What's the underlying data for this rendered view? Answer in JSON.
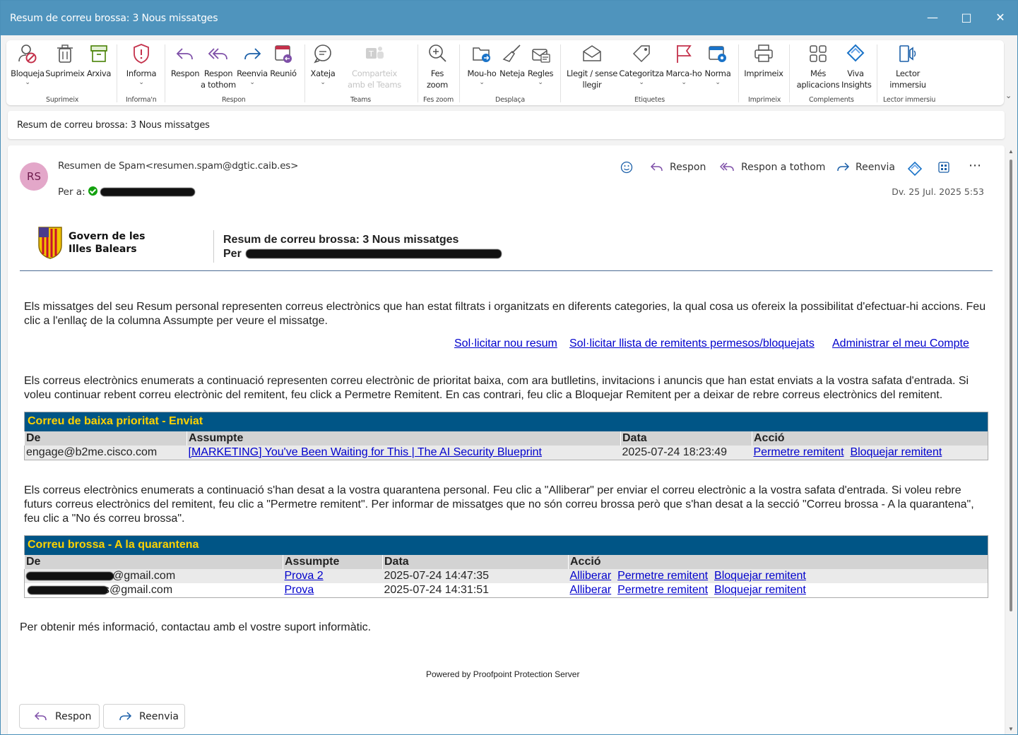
{
  "window": {
    "title": "Resum de correu brossa: 3 Nous missatges"
  },
  "ribbon": {
    "buttons": [
      {
        "label": "Bloqueja"
      },
      {
        "label": "Suprimeix"
      },
      {
        "label": "Arxiva"
      },
      {
        "label": "Informa"
      },
      {
        "label": "Respon"
      },
      {
        "label": "Respon a tothom"
      },
      {
        "label": "Reenvia"
      },
      {
        "label": "Reunió"
      },
      {
        "label": "Xateja"
      },
      {
        "label": "Comparteix amb el Teams"
      },
      {
        "label": "Fes zoom"
      },
      {
        "label": "Mou-ho"
      },
      {
        "label": "Neteja"
      },
      {
        "label": "Regles"
      },
      {
        "label": "Llegit / sense llegir"
      },
      {
        "label": "Categoritza"
      },
      {
        "label": "Marca-ho"
      },
      {
        "label": "Norma"
      },
      {
        "label": "Imprimeix"
      },
      {
        "label": "Més aplicacions"
      },
      {
        "label": "Viva Insights"
      },
      {
        "label": "Lector immersiu"
      }
    ],
    "groups": [
      "Suprimeix",
      "Informa'n",
      "Respon",
      "Teams",
      "Fes zoom",
      "Desplaça",
      "Etiquetes",
      "Imprimeix",
      "Complements",
      "Lector immersiu"
    ]
  },
  "subject": "Resum de correu brossa: 3 Nous missatges",
  "message": {
    "avatar": "RS",
    "sender": "Resumen de Spam<resumen.spam@dgtic.caib.es>",
    "to_label": "Per a:",
    "date": "Dv. 25 Jul. 2025 5:53",
    "actions": {
      "reply": "Respon",
      "reply_all": "Respon a tothom",
      "forward": "Reenvia"
    }
  },
  "email": {
    "logo_line1": "Govern de les",
    "logo_line2": "Illes Balears",
    "header_title": "Resum de correu brossa: 3 Nous missatges",
    "header_per": "Per",
    "intro": "Els missatges del seu Resum personal representen correus electrònics que han estat filtrats i organitzats en diferents categories, la qual cosa us ofereix la possibilitat d'efectuar-hi accions. Feu clic a l'enllaç de la columna Assumpte per veure el missatge.",
    "links": [
      "Sol·licitar nou resum",
      "Sol·licitar llista de remitents permesos/bloquejats",
      "Administrar el meu Compte"
    ],
    "low_priority_text": "Els correus electrònics enumerats a continuació representen correu electrònic de prioritat baixa, com ara butlletins, invitacions i anuncis que han estat enviats a la vostra safata d'entrada. Si voleu continuar rebent correu electrònic del remitent, feu click a Permetre Remitent. En cas contrari, feu clic a Bloquejar Remitent per a deixar de rebre correus electrònics del remitent.",
    "low_table": {
      "title": "Correu de baixa prioritat - Enviat",
      "headers": [
        "De",
        "Assumpte",
        "Data",
        "Acció"
      ],
      "rows": [
        {
          "from": "engage@b2me.cisco.com",
          "subject": "[MARKETING] You've Been Waiting for This | The AI Security Blueprint",
          "date": "2025-07-24 18:23:49",
          "actions": [
            "Permetre remitent",
            "Bloquejar remitent"
          ]
        }
      ]
    },
    "quarantine_text": "Els correus electrònics enumerats a continuació s'han desat a la vostra quarantena personal. Feu clic a \"Alliberar\" per enviar el correu electrònic a la vostra safata d'entrada. Si voleu rebre futurs correus electrònics del remitent, feu clic a \"Permetre remitent\". Per informar de missatges que no són correu brossa però que s'han desat a la secció \"Correu brossa - A la quarantena\", feu clic a \"No és correu brossa\".",
    "q_table": {
      "title": "Correu brossa - A la quarantena",
      "headers": [
        "De",
        "Assumpte",
        "Data",
        "Acció"
      ],
      "rows": [
        {
          "from": "@gmail.com",
          "subject": "Prova 2",
          "date": "2025-07-24 14:47:35",
          "actions": [
            "Alliberar",
            "Permetre remitent",
            "Bloquejar remitent"
          ]
        },
        {
          "from": "s@gmail.com",
          "subject": "Prova",
          "date": "2025-07-24 14:31:51",
          "actions": [
            "Alliberar",
            "Permetre remitent",
            "Bloquejar remitent"
          ]
        }
      ]
    },
    "footer": "Per obtenir més informació, contactau amb el vostre suport informàtic.",
    "powered": "Powered by Proofpoint Protection Server"
  },
  "bottom": {
    "reply": "Respon",
    "forward": "Reenvia"
  }
}
